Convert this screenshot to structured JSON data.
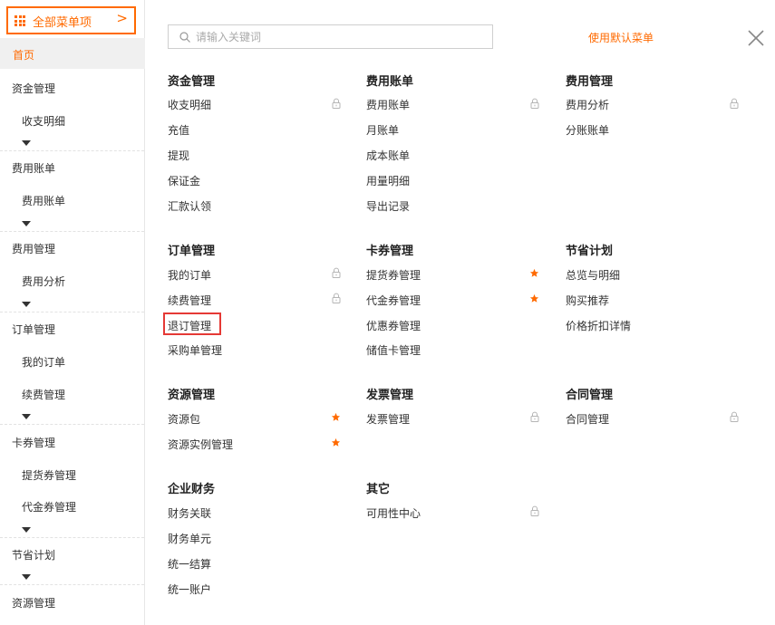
{
  "sidebar": {
    "all_menu_label": "全部菜单项",
    "home_label": "首页",
    "groups": [
      {
        "title": "资金管理",
        "items": [
          "收支明细"
        ]
      },
      {
        "title": "费用账单",
        "items": [
          "费用账单"
        ]
      },
      {
        "title": "费用管理",
        "items": [
          "费用分析"
        ]
      },
      {
        "title": "订单管理",
        "items": [
          "我的订单",
          "续费管理"
        ]
      },
      {
        "title": "卡券管理",
        "items": [
          "提货券管理",
          "代金券管理"
        ]
      },
      {
        "title": "节省计划",
        "items": []
      },
      {
        "title": "资源管理",
        "items": []
      }
    ]
  },
  "search": {
    "placeholder": "请输入关键词",
    "value": ""
  },
  "default_menu_label": "使用默认菜单",
  "sections": {
    "s1": {
      "title": "资金管理",
      "items": [
        "收支明细",
        "充值",
        "提现",
        "保证金",
        "汇款认领"
      ]
    },
    "s2": {
      "title": "费用账单",
      "items": [
        "费用账单",
        "月账单",
        "成本账单",
        "用量明细",
        "导出记录"
      ]
    },
    "s3": {
      "title": "费用管理",
      "items": [
        "费用分析",
        "分账账单"
      ]
    },
    "s4": {
      "title": "订单管理",
      "items": [
        "我的订单",
        "续费管理",
        "退订管理",
        "采购单管理"
      ]
    },
    "s5": {
      "title": "卡券管理",
      "items": [
        "提货券管理",
        "代金券管理",
        "优惠券管理",
        "储值卡管理"
      ]
    },
    "s6": {
      "title": "节省计划",
      "items": [
        "总览与明细",
        "购买推荐",
        "价格折扣详情"
      ]
    },
    "s7": {
      "title": "资源管理",
      "items": [
        "资源包",
        "资源实例管理"
      ]
    },
    "s8": {
      "title": "发票管理",
      "items": [
        "发票管理"
      ]
    },
    "s9": {
      "title": "合同管理",
      "items": [
        "合同管理"
      ]
    },
    "s10": {
      "title": "企业财务",
      "items": [
        "财务关联",
        "财务单元",
        "统一结算",
        "统一账户"
      ]
    },
    "s11": {
      "title": "其它",
      "items": [
        "可用性中心"
      ]
    }
  },
  "icons": {
    "lock": "lock-icon",
    "star": "star-icon",
    "grid": "grid-icon",
    "close": "close-icon",
    "search": "search-icon"
  },
  "colors": {
    "accent": "#ff6a00",
    "highlight_box": "#e53935",
    "lock": "#b5b5b5"
  }
}
